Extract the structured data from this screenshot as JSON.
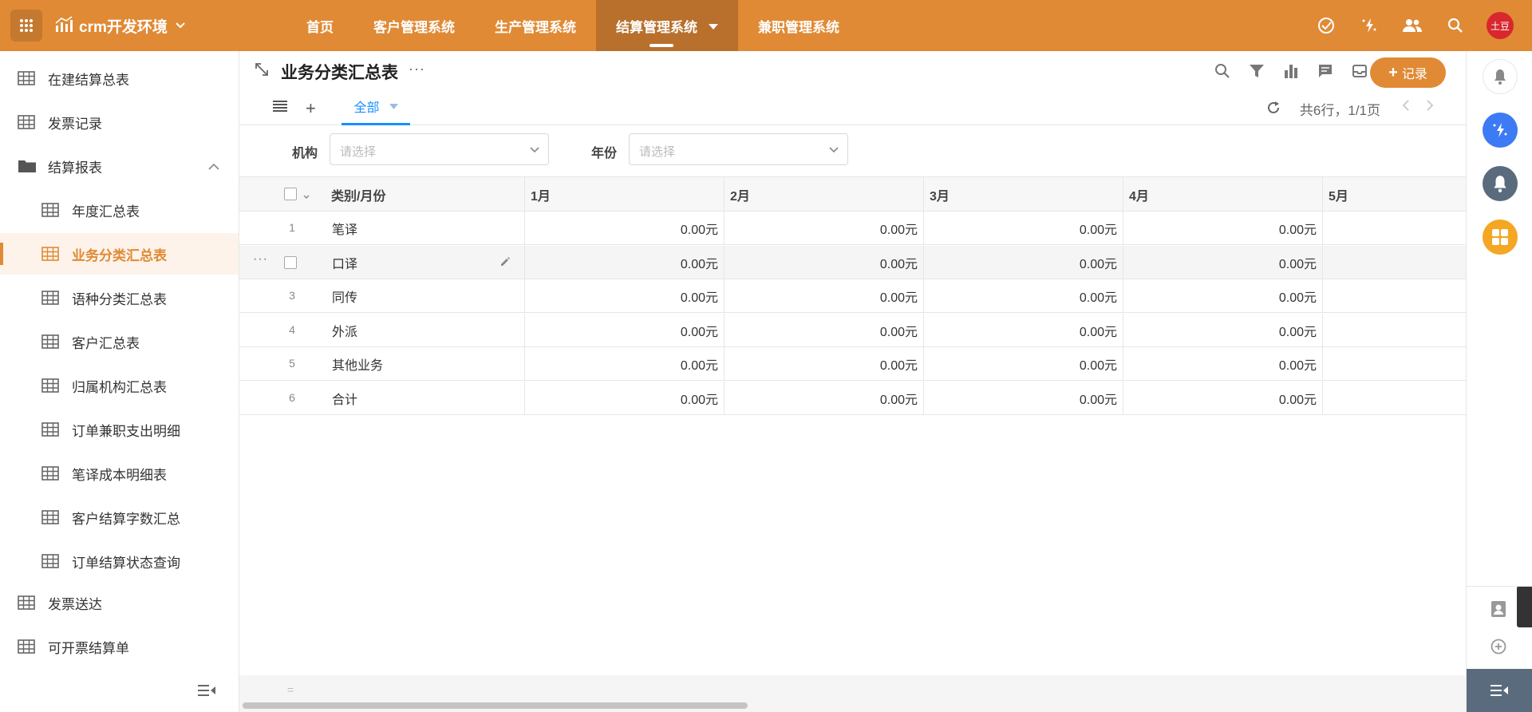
{
  "topbar": {
    "brand_name": "crm开发环境",
    "nav": [
      {
        "label": "首页",
        "active": false
      },
      {
        "label": "客户管理系统",
        "active": false
      },
      {
        "label": "生产管理系统",
        "active": false
      },
      {
        "label": "结算管理系统",
        "active": true
      },
      {
        "label": "兼职管理系统",
        "active": false
      }
    ],
    "avatar_text": "土豆",
    "accent_color": "#e08a35",
    "icons": [
      "apps-grid-icon",
      "chart-logo-icon",
      "check-circle-icon",
      "magic-icon",
      "users-icon",
      "search-icon"
    ]
  },
  "sidebar": {
    "items": [
      {
        "label": "在建结算总表",
        "level": 1,
        "icon": "table-icon"
      },
      {
        "label": "发票记录",
        "level": 1,
        "icon": "table-icon"
      },
      {
        "label": "结算报表",
        "level": 1,
        "icon": "folder-icon",
        "expanded": true
      },
      {
        "label": "年度汇总表",
        "level": 2,
        "icon": "table-icon"
      },
      {
        "label": "业务分类汇总表",
        "level": 2,
        "icon": "table-icon",
        "active": true
      },
      {
        "label": "语种分类汇总表",
        "level": 2,
        "icon": "table-icon"
      },
      {
        "label": "客户汇总表",
        "level": 2,
        "icon": "table-icon"
      },
      {
        "label": "归属机构汇总表",
        "level": 2,
        "icon": "table-icon"
      },
      {
        "label": "订单兼职支出明细",
        "level": 2,
        "icon": "table-icon"
      },
      {
        "label": "笔译成本明细表",
        "level": 2,
        "icon": "table-icon"
      },
      {
        "label": "客户结算字数汇总",
        "level": 2,
        "icon": "table-icon"
      },
      {
        "label": "订单结算状态查询",
        "level": 2,
        "icon": "table-icon"
      },
      {
        "label": "发票送达",
        "level": 1,
        "icon": "table-icon"
      },
      {
        "label": "可开票结算单",
        "level": 1,
        "icon": "table-icon"
      }
    ]
  },
  "main": {
    "title": "业务分类汇总表",
    "title_more": "···",
    "add_record_label": "记录",
    "view_tab_label": "全部",
    "pager_text": "共6行，1/1页",
    "filters": [
      {
        "label": "机构",
        "placeholder": "请选择"
      },
      {
        "label": "年份",
        "placeholder": "请选择"
      }
    ],
    "table": {
      "columns": [
        "类别/月份",
        "1月",
        "2月",
        "3月",
        "4月",
        "5月"
      ],
      "rows": [
        {
          "num": "1",
          "category": "笔译",
          "values": [
            "0.00元",
            "0.00元",
            "0.00元",
            "0.00元",
            ""
          ]
        },
        {
          "num": "2",
          "category": "口译",
          "values": [
            "0.00元",
            "0.00元",
            "0.00元",
            "0.00元",
            ""
          ]
        },
        {
          "num": "3",
          "category": "同传",
          "values": [
            "0.00元",
            "0.00元",
            "0.00元",
            "0.00元",
            ""
          ]
        },
        {
          "num": "4",
          "category": "外派",
          "values": [
            "0.00元",
            "0.00元",
            "0.00元",
            "0.00元",
            ""
          ]
        },
        {
          "num": "5",
          "category": "其他业务",
          "values": [
            "0.00元",
            "0.00元",
            "0.00元",
            "0.00元",
            ""
          ]
        },
        {
          "num": "6",
          "category": "合计",
          "values": [
            "0.00元",
            "0.00元",
            "0.00元",
            "0.00元",
            ""
          ]
        }
      ],
      "hovered_row": 1
    }
  }
}
